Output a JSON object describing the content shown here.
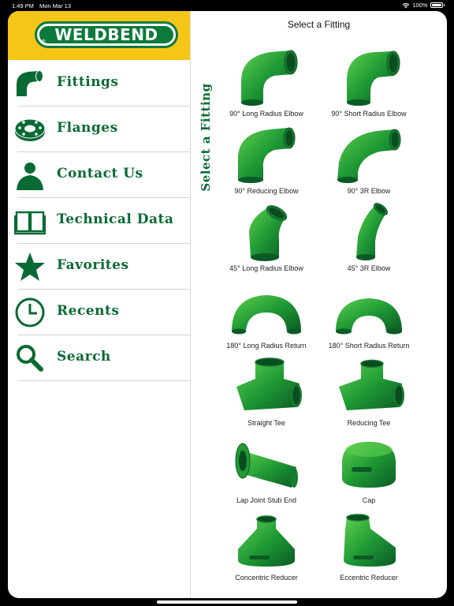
{
  "status_bar": {
    "time": "1:49 PM",
    "date": "Mon Mar 13",
    "battery": "100%"
  },
  "brand": {
    "logo_text": "WELDBEND",
    "registered_mark": "®",
    "primary_color": "#0c7a3a",
    "accent_yellow": "#f5c518"
  },
  "sidebar": {
    "items": [
      {
        "label": "Fittings",
        "icon": "elbow-icon"
      },
      {
        "label": "Flanges",
        "icon": "flange-icon"
      },
      {
        "label": "Contact Us",
        "icon": "person-icon"
      },
      {
        "label": "Technical Data",
        "icon": "book-icon"
      },
      {
        "label": "Favorites",
        "icon": "star-icon"
      },
      {
        "label": "Recents",
        "icon": "clock-icon"
      },
      {
        "label": "Search",
        "icon": "magnifier-icon"
      }
    ]
  },
  "side_title": "Select a Fitting",
  "main": {
    "title": "Select a Fitting",
    "fittings": [
      "90° Long Radius Elbow",
      "90° Short Radius Elbow",
      "90° Reducing Elbow",
      "90° 3R Elbow",
      "45° Long Radius Elbow",
      "45° 3R Elbow",
      "180° Long Radius Return",
      "180° Short Radius Return",
      "Straight Tee",
      "Reducing Tee",
      "Lap Joint Stub End",
      "Cap",
      "Concentric Reducer",
      "Eccentric Reducer"
    ]
  }
}
